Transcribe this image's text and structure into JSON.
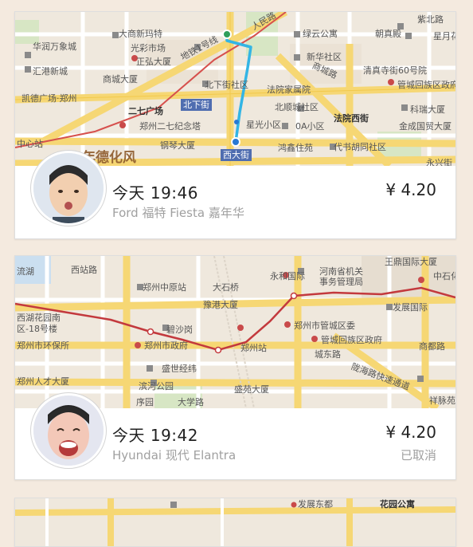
{
  "trips": [
    {
      "time": "今天 19:46",
      "car": "Ford 福特 Fiesta 嘉年华",
      "price": "¥ 4.20",
      "status": "",
      "map_labels": [
        "大商新玛特",
        "绿云公寓",
        "朝真殿",
        "紫北路",
        "华润万象城",
        "光彩市场",
        "新华社区",
        "星月花",
        "汇港新城",
        "正弘大厦",
        "清真寺街60号院",
        "商城大厦",
        "北下街社区",
        "法院家属院",
        "管城回族区政府",
        "凯德广场·郑州",
        "北下街",
        "北顺城社区",
        "科瑞大厦",
        "二七广场",
        "郑州二七纪念塔",
        "星光小区",
        "0A小区",
        "法院西街",
        "金成国贸大厦",
        "中心站",
        "钢琴大厦",
        "西大街",
        "鸿鑫住苑",
        "代书胡同社区",
        "人民路",
        "地铁1号线",
        "商城路",
        "永兴街",
        "年德化风"
      ]
    },
    {
      "time": "今天 19:42",
      "car": "Hyundai 现代 Elantra",
      "price": "¥ 4.20",
      "status": "已取消",
      "map_labels": [
        "流湖",
        "西站路",
        "郑州中原站",
        "大石桥",
        "永和国际",
        "河南省机关",
        "事务管理局",
        "王鼎国际大厦",
        "中石化",
        "豫港大厦",
        "发展国际",
        "西湖花园南",
        "区-18号楼",
        "碧沙岗",
        "郑州市管城区委",
        "郑州市环保所",
        "郑州市政府",
        "郑州站",
        "管城回族区政府",
        "商都路",
        "盛世经纬",
        "城东路",
        "陇海路快速通道",
        "郑州人才大厦",
        "滨河公园",
        "盛苑大厦",
        "祥脉苑",
        "序园",
        "大学路"
      ]
    },
    {
      "map_labels": [
        "发展东都",
        "花园公寓"
      ]
    }
  ]
}
